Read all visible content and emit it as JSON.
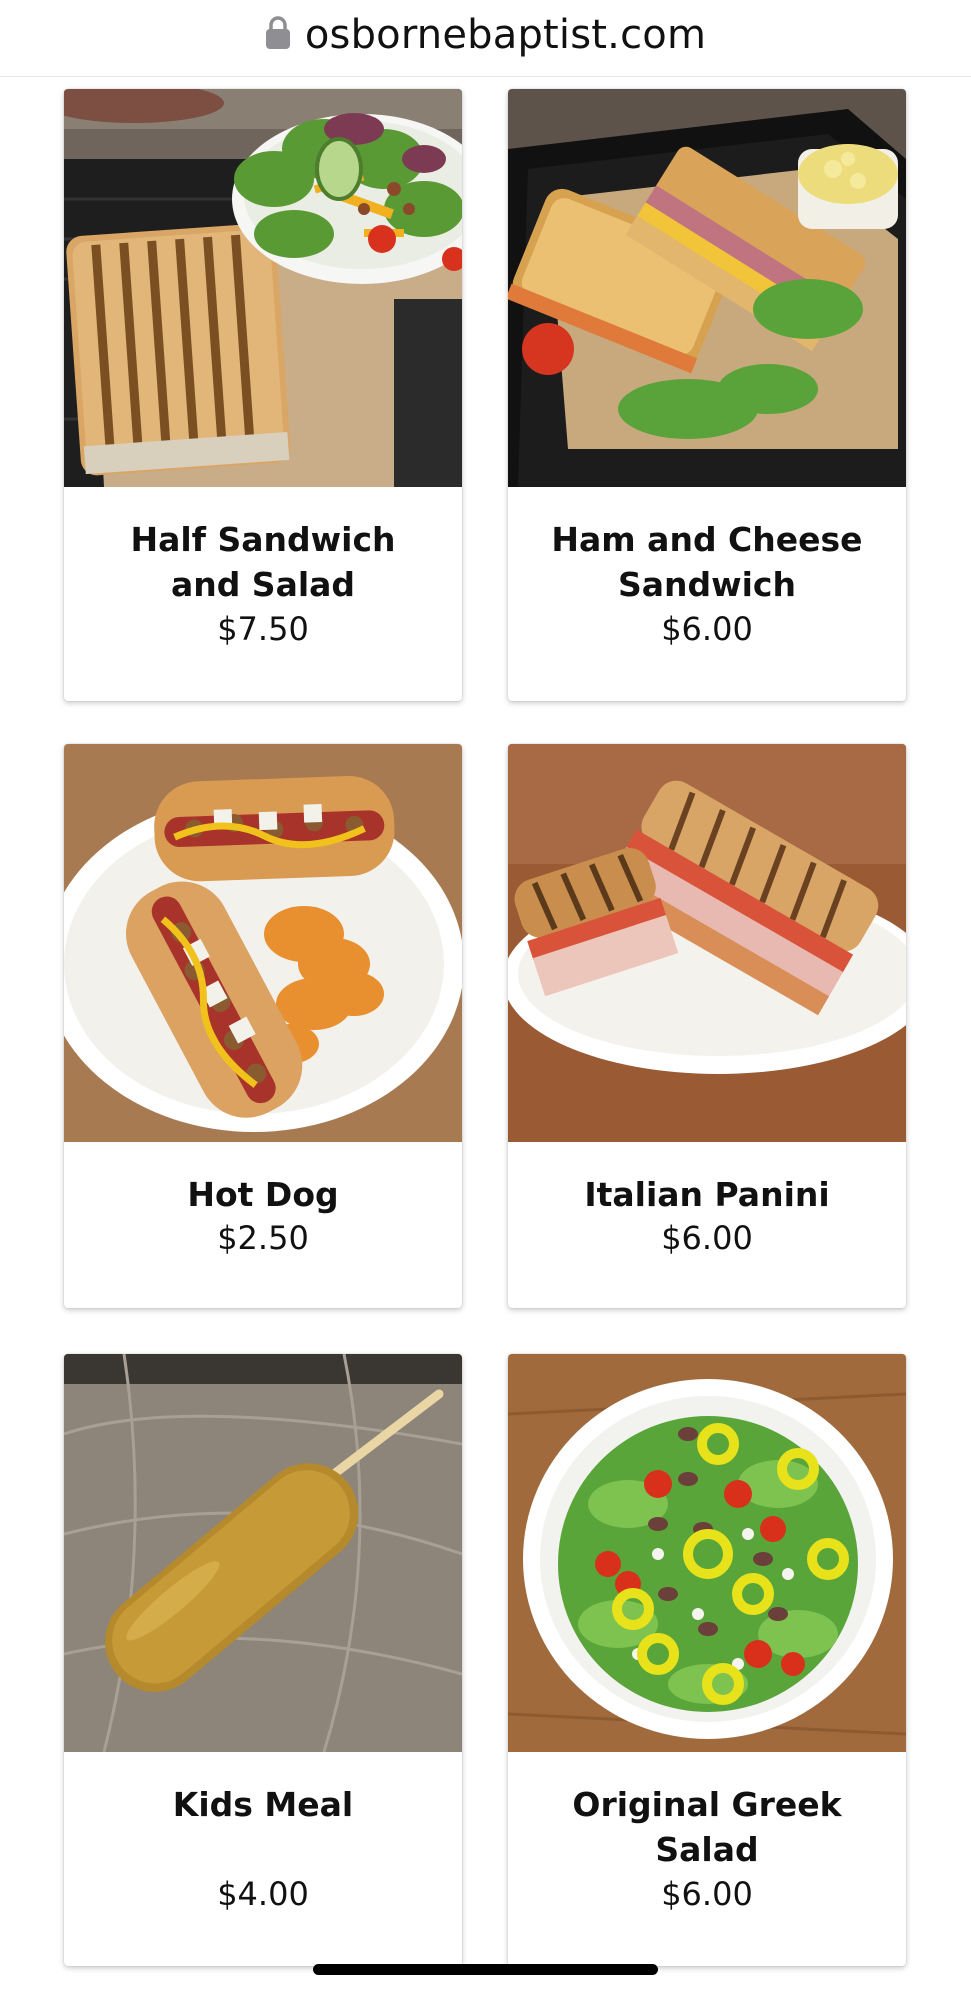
{
  "browser": {
    "url": "osbornebaptist.com",
    "lock_icon": "lock-icon"
  },
  "menu_items": [
    {
      "name_line1": "Half Sandwich",
      "name_line2": "and Salad",
      "price": "$7.50",
      "photo": "panini-with-side-salad"
    },
    {
      "name_line1": "Ham and Cheese",
      "name_line2": "Sandwich",
      "price": "$6.00",
      "photo": "ham-cheese-sandwich-with-potato-salad"
    },
    {
      "name_line1": "Hot Dog",
      "name_line2": "",
      "price": "$2.50",
      "photo": "chili-hot-dogs-with-chips"
    },
    {
      "name_line1": "Italian Panini",
      "name_line2": "",
      "price": "$6.00",
      "photo": "italian-panini"
    },
    {
      "name_line1": "Kids Meal",
      "name_line2": "",
      "price": "$4.00",
      "photo": "corn-dog"
    },
    {
      "name_line1": "Original Greek",
      "name_line2": "Salad",
      "price": "$6.00",
      "photo": "greek-salad-bowl"
    }
  ]
}
